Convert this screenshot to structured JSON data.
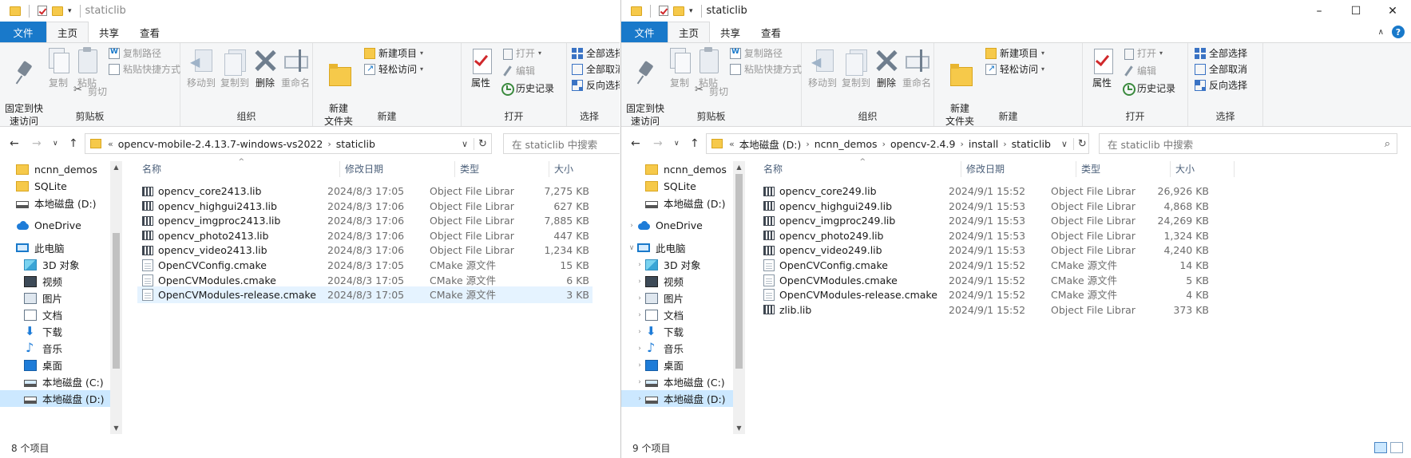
{
  "windows": [
    {
      "id": "left",
      "title": "staticlib",
      "tabs": [
        "文件",
        "主页",
        "共享",
        "查看"
      ],
      "ribbon": {
        "clipboard": {
          "label": "剪贴板",
          "pin": "固定到快\n速访问",
          "copy": "复制",
          "paste": "粘贴",
          "copy_path": "复制路径",
          "paste_shortcut": "粘贴快捷方式",
          "cut": "剪切"
        },
        "organize": {
          "label": "组织",
          "move_to": "移动到",
          "copy_to": "复制到",
          "delete": "删除",
          "rename": "重命名"
        },
        "new": {
          "label": "新建",
          "new_folder": "新建\n文件夹",
          "new_item": "新建项目",
          "easy_access": "轻松访问"
        },
        "open": {
          "label": "打开",
          "properties": "属性",
          "open": "打开",
          "edit": "编辑",
          "history": "历史记录"
        },
        "select": {
          "label": "选择",
          "select_all": "全部选择",
          "select_none": "全部取消",
          "invert": "反向选择"
        }
      },
      "address": {
        "prefix": "«",
        "crumbs": [
          "opencv-mobile-2.4.13.7-windows-vs2022",
          "staticlib"
        ],
        "separators": [
          "›"
        ]
      },
      "search_placeholder": "在 staticlib 中搜索",
      "nav": [
        {
          "label": "ncnn_demos",
          "icon": "folder-icon"
        },
        {
          "label": "SQLite",
          "icon": "folder-icon"
        },
        {
          "label": "本地磁盘 (D:)",
          "icon": "drive-icon"
        },
        {
          "label": "OneDrive",
          "icon": "cloud-icon"
        },
        {
          "label": "此电脑",
          "icon": "computer-icon"
        },
        {
          "label": "3D 对象",
          "icon": "3d-objects-icon"
        },
        {
          "label": "视频",
          "icon": "video-icon"
        },
        {
          "label": "图片",
          "icon": "pictures-icon"
        },
        {
          "label": "文档",
          "icon": "documents-icon"
        },
        {
          "label": "下载",
          "icon": "download-icon"
        },
        {
          "label": "音乐",
          "icon": "music-icon"
        },
        {
          "label": "桌面",
          "icon": "desktop-icon"
        },
        {
          "label": "本地磁盘 (C:)",
          "icon": "system-drive-icon"
        },
        {
          "label": "本地磁盘 (D:)",
          "icon": "drive-icon",
          "selected": true
        }
      ],
      "columns": [
        "名称",
        "修改日期",
        "类型",
        "大小"
      ],
      "files": [
        {
          "name": "opencv_core2413.lib",
          "date": "2024/8/3 17:05",
          "type": "Object File Library",
          "size": "7,275 KB",
          "icon": "library-file-icon"
        },
        {
          "name": "opencv_highgui2413.lib",
          "date": "2024/8/3 17:06",
          "type": "Object File Library",
          "size": "627 KB",
          "icon": "library-file-icon"
        },
        {
          "name": "opencv_imgproc2413.lib",
          "date": "2024/8/3 17:06",
          "type": "Object File Library",
          "size": "7,885 KB",
          "icon": "library-file-icon"
        },
        {
          "name": "opencv_photo2413.lib",
          "date": "2024/8/3 17:06",
          "type": "Object File Library",
          "size": "447 KB",
          "icon": "library-file-icon"
        },
        {
          "name": "opencv_video2413.lib",
          "date": "2024/8/3 17:06",
          "type": "Object File Library",
          "size": "1,234 KB",
          "icon": "library-file-icon"
        },
        {
          "name": "OpenCVConfig.cmake",
          "date": "2024/8/3 17:05",
          "type": "CMake 源文件",
          "size": "15 KB",
          "icon": "cmake-file-icon"
        },
        {
          "name": "OpenCVModules.cmake",
          "date": "2024/8/3 17:05",
          "type": "CMake 源文件",
          "size": "6 KB",
          "icon": "cmake-file-icon"
        },
        {
          "name": "OpenCVModules-release.cmake",
          "date": "2024/8/3 17:05",
          "type": "CMake 源文件",
          "size": "3 KB",
          "icon": "cmake-file-icon",
          "selected": true
        }
      ],
      "status": "8 个项目"
    },
    {
      "id": "right",
      "title": "staticlib",
      "tabs": [
        "文件",
        "主页",
        "共享",
        "查看"
      ],
      "window_controls": [
        "–",
        "☐",
        "✕"
      ],
      "ribbon": {
        "clipboard": {
          "label": "剪贴板",
          "pin": "固定到快\n速访问",
          "copy": "复制",
          "paste": "粘贴",
          "copy_path": "复制路径",
          "paste_shortcut": "粘贴快捷方式",
          "cut": "剪切"
        },
        "organize": {
          "label": "组织",
          "move_to": "移动到",
          "copy_to": "复制到",
          "delete": "删除",
          "rename": "重命名"
        },
        "new": {
          "label": "新建",
          "new_folder": "新建\n文件夹",
          "new_item": "新建项目",
          "easy_access": "轻松访问"
        },
        "open": {
          "label": "打开",
          "properties": "属性",
          "open": "打开",
          "edit": "编辑",
          "history": "历史记录"
        },
        "select": {
          "label": "选择",
          "select_all": "全部选择",
          "select_none": "全部取消",
          "invert": "反向选择"
        }
      },
      "address": {
        "prefix": "«",
        "crumbs": [
          "本地磁盘 (D:)",
          "ncnn_demos",
          "opencv-2.4.9",
          "install",
          "staticlib"
        ],
        "separators": [
          "›"
        ]
      },
      "search_placeholder": "在 staticlib 中搜索",
      "nav": [
        {
          "label": "ncnn_demos",
          "icon": "folder-icon"
        },
        {
          "label": "SQLite",
          "icon": "folder-icon"
        },
        {
          "label": "本地磁盘 (D:)",
          "icon": "drive-icon"
        },
        {
          "label": "OneDrive",
          "icon": "cloud-icon"
        },
        {
          "label": "此电脑",
          "icon": "computer-icon"
        },
        {
          "label": "3D 对象",
          "icon": "3d-objects-icon"
        },
        {
          "label": "视频",
          "icon": "video-icon"
        },
        {
          "label": "图片",
          "icon": "pictures-icon"
        },
        {
          "label": "文档",
          "icon": "documents-icon"
        },
        {
          "label": "下载",
          "icon": "download-icon"
        },
        {
          "label": "音乐",
          "icon": "music-icon"
        },
        {
          "label": "桌面",
          "icon": "desktop-icon"
        },
        {
          "label": "本地磁盘 (C:)",
          "icon": "system-drive-icon"
        },
        {
          "label": "本地磁盘 (D:)",
          "icon": "drive-icon",
          "selected": true
        }
      ],
      "columns": [
        "名称",
        "修改日期",
        "类型",
        "大小"
      ],
      "files": [
        {
          "name": "opencv_core249.lib",
          "date": "2024/9/1 15:52",
          "type": "Object File Library",
          "size": "26,926 KB",
          "icon": "library-file-icon"
        },
        {
          "name": "opencv_highgui249.lib",
          "date": "2024/9/1 15:53",
          "type": "Object File Library",
          "size": "4,868 KB",
          "icon": "library-file-icon"
        },
        {
          "name": "opencv_imgproc249.lib",
          "date": "2024/9/1 15:53",
          "type": "Object File Library",
          "size": "24,269 KB",
          "icon": "library-file-icon"
        },
        {
          "name": "opencv_photo249.lib",
          "date": "2024/9/1 15:53",
          "type": "Object File Library",
          "size": "1,324 KB",
          "icon": "library-file-icon"
        },
        {
          "name": "opencv_video249.lib",
          "date": "2024/9/1 15:53",
          "type": "Object File Library",
          "size": "4,240 KB",
          "icon": "library-file-icon"
        },
        {
          "name": "OpenCVConfig.cmake",
          "date": "2024/9/1 15:52",
          "type": "CMake 源文件",
          "size": "14 KB",
          "icon": "cmake-file-icon"
        },
        {
          "name": "OpenCVModules.cmake",
          "date": "2024/9/1 15:52",
          "type": "CMake 源文件",
          "size": "5 KB",
          "icon": "cmake-file-icon"
        },
        {
          "name": "OpenCVModules-release.cmake",
          "date": "2024/9/1 15:52",
          "type": "CMake 源文件",
          "size": "4 KB",
          "icon": "cmake-file-icon"
        },
        {
          "name": "zlib.lib",
          "date": "2024/9/1 15:52",
          "type": "Object File Library",
          "size": "373 KB",
          "icon": "library-file-icon"
        }
      ],
      "status": "9 个项目"
    }
  ],
  "colors": {
    "accent": "#1979ca",
    "selection": "#cce8ff",
    "hover_row": "#e5f3ff"
  }
}
